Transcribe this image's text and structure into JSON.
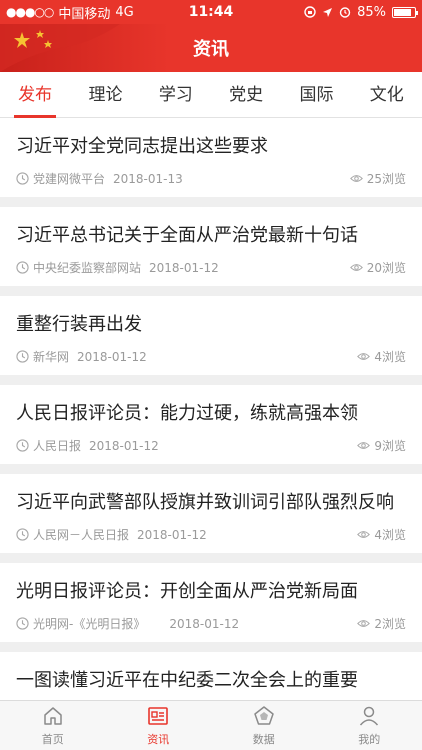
{
  "status_bar": {
    "signal": "●●●○○",
    "carrier": "中国移动",
    "network": "4G",
    "time": "11:44",
    "battery": "85%",
    "battery_level": 0.85
  },
  "header": {
    "title": "资讯"
  },
  "tabs": [
    {
      "label": "发布",
      "active": true
    },
    {
      "label": "理论",
      "active": false
    },
    {
      "label": "学习",
      "active": false
    },
    {
      "label": "党史",
      "active": false
    },
    {
      "label": "国际",
      "active": false
    },
    {
      "label": "文化",
      "active": false
    }
  ],
  "news": [
    {
      "title": "习近平对全党同志提出这些要求",
      "source": "党建网微平台",
      "date": "2018-01-13",
      "views": "25浏览"
    },
    {
      "title": "习近平总书记关于全面从严治党最新十句话",
      "source": "中央纪委监察部网站",
      "date": "2018-01-12",
      "views": "20浏览"
    },
    {
      "title": "重整行装再出发",
      "source": "新华网",
      "date": "2018-01-12",
      "views": "4浏览"
    },
    {
      "title": "人民日报评论员：能力过硬，练就高强本领",
      "source": "人民日报",
      "date": "2018-01-12",
      "views": "9浏览"
    },
    {
      "title": "习近平向武警部队授旗并致训词引部队强烈反响",
      "source": "人民网－人民日报",
      "date": "2018-01-12",
      "views": "4浏览"
    },
    {
      "title": "光明日报评论员：开创全面从严治党新局面",
      "source": "光明网-《光明日报》",
      "date": "2018-01-12",
      "views": "2浏览"
    },
    {
      "title": "一图读懂习近平在中纪委二次全会上的重要",
      "source": "",
      "date": "",
      "views": ""
    }
  ],
  "bottom_nav": [
    {
      "label": "首页",
      "icon": "home-icon",
      "active": false
    },
    {
      "label": "资讯",
      "icon": "news-icon",
      "active": true
    },
    {
      "label": "数据",
      "icon": "data-icon",
      "active": false
    },
    {
      "label": "我的",
      "icon": "profile-icon",
      "active": false
    }
  ],
  "colors": {
    "accent": "#e8352b",
    "inactive": "#8a8a8a"
  }
}
